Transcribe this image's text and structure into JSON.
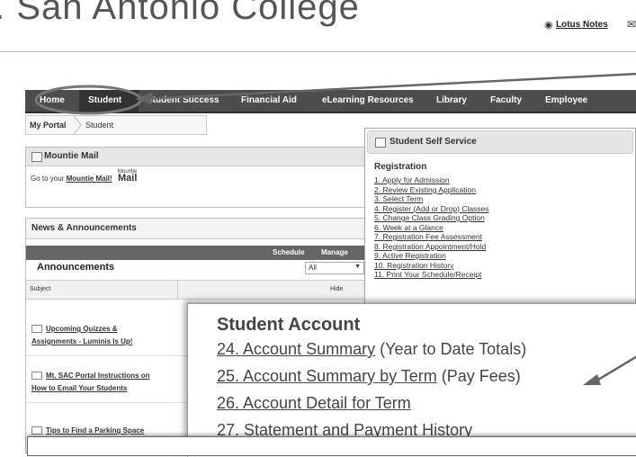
{
  "header": {
    "college_title": "t. San Antonio College",
    "lotus_notes_label": "Lotus Notes"
  },
  "nav": {
    "items": [
      "Home",
      "Student",
      "Student Success",
      "Financial Aid",
      "eLearning Resources",
      "Library",
      "Faculty",
      "Employee"
    ],
    "active": "Student"
  },
  "breadcrumb": {
    "items": [
      "My Portal",
      "Student"
    ]
  },
  "mountie_mail": {
    "title": "Mountie Mail",
    "text_prefix": "Go to your ",
    "link_label": "Mountie Mail!",
    "logo_small": "Mountie",
    "logo_big": "Mail"
  },
  "news": {
    "title": "News & Announcements",
    "bar_schedule": "Schedule",
    "bar_manage": "Manage",
    "announcements_label": "Announcements",
    "filter_value": "All",
    "col_subject": "Subject",
    "col_hide": "Hide",
    "items": [
      [
        "Upcoming Quizzes &",
        "Assignments - Luminis Is Up!"
      ],
      [
        "Mt. SAC Portal Instructions on",
        "How to Email Your Students"
      ],
      [
        "Tips to Find a Parking Space"
      ]
    ]
  },
  "self_service": {
    "title": "Student Self Service",
    "registration_title": "Registration",
    "registration_items": [
      "1. Apply for Admission",
      "2. Review Existing Application",
      "3. Select Term",
      "4. Register (Add or Drop) Classes",
      "5. Change Class Grading Option",
      "6. Week at a Glance",
      "7. Registration Fee Assessment",
      "8. Registration Appointment/Hold",
      "9. Active Registration",
      "10. Registration History",
      "11. Print Your Schedule/Receipt"
    ]
  },
  "student_account": {
    "title": "Student Account",
    "items": [
      {
        "link": "24. Account Summary",
        "note": " (Year to Date Totals)"
      },
      {
        "link": "25. Account Summary by Term",
        "note": " (Pay Fees)"
      },
      {
        "link": "26. Account Detail for Term",
        "note": ""
      },
      {
        "link": "27. Statement and Payment History",
        "note": ""
      }
    ]
  },
  "colors": {
    "nav_bg": "#4d4d4d",
    "panel_head": "#e6e6e6",
    "text": "#333333"
  }
}
